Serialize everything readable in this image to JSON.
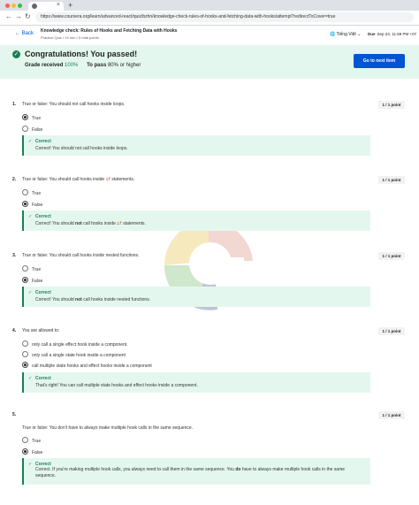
{
  "browser": {
    "url": "https://www.coursera.org/learn/advanced-react/quiz/bzhn/knowledge-check-rules-of-hooks-and-fetching-data-with-hooks/attempt?redirectToCover=true",
    "new_tab": "+"
  },
  "header": {
    "back": "Back",
    "title": "Knowledge check: Rules of Hooks and Fetching Data with Hooks",
    "subtitle": "Practice Quiz • 10 min • 5 total points",
    "language": "Tiếng Việt",
    "due_label": "Due",
    "due_value": "Sep 23, 11:59 PM +07"
  },
  "banner": {
    "title": "Congratulations! You passed!",
    "grade_label": "Grade received",
    "grade_value": "100%",
    "pass_label": "To pass",
    "pass_value": "80% or higher",
    "button": "Go to next item"
  },
  "questions": [
    {
      "num": "1.",
      "points": "1 / 1 point",
      "text": "True or false: You should not call hooks inside loops.",
      "options": [
        "True",
        "False"
      ],
      "feedback_title": "Correct",
      "feedback_msg": "Correct! You should not call hooks inside loops."
    },
    {
      "num": "2.",
      "points": "1 / 1 point",
      "text_before": "True or false: You should call hooks inside",
      "code": "if",
      "text_after": "statements.",
      "options": [
        "True",
        "False"
      ],
      "feedback_title": "Correct",
      "fb_before": "Correct! You should",
      "fb_bold": "not",
      "fb_mid": "call hooks inside",
      "fb_code": "if",
      "fb_after": "statements."
    },
    {
      "num": "3.",
      "points": "1 / 1 point",
      "text": "True or false: You should call hooks inside nested functions.",
      "options": [
        "True",
        "False"
      ],
      "feedback_title": "Correct",
      "fb_before": "Correct! You should",
      "fb_bold": "not",
      "fb_after": "call hooks inside nested functions."
    },
    {
      "num": "4.",
      "points": "1 / 1 point",
      "text": "You are allowed to:",
      "options": [
        "only call a single effect hook inside a component.",
        "only call a single state hook inside a component",
        "call multiple state hooks and effect hooks inside a component"
      ],
      "feedback_title": "Correct",
      "feedback_msg": "That's right! You can call multiple state hooks and effect hooks inside a component."
    },
    {
      "num": "5.",
      "points": "1 / 1 point",
      "text": "True or false: You don't have to always make multiple hook calls in the same sequence.",
      "options": [
        "True",
        "False"
      ],
      "feedback_title": "Correct",
      "fb_before": "Correct. If you're making multiple hook calls, you always need to call them in the same sequence. You",
      "fb_bold": "do",
      "fb_after": "have to always make multiple hook calls in the same sequence."
    }
  ],
  "colors": {
    "accent": "#0056d2",
    "success": "#1a7f52",
    "banner_bg": "#e4f7ef"
  }
}
